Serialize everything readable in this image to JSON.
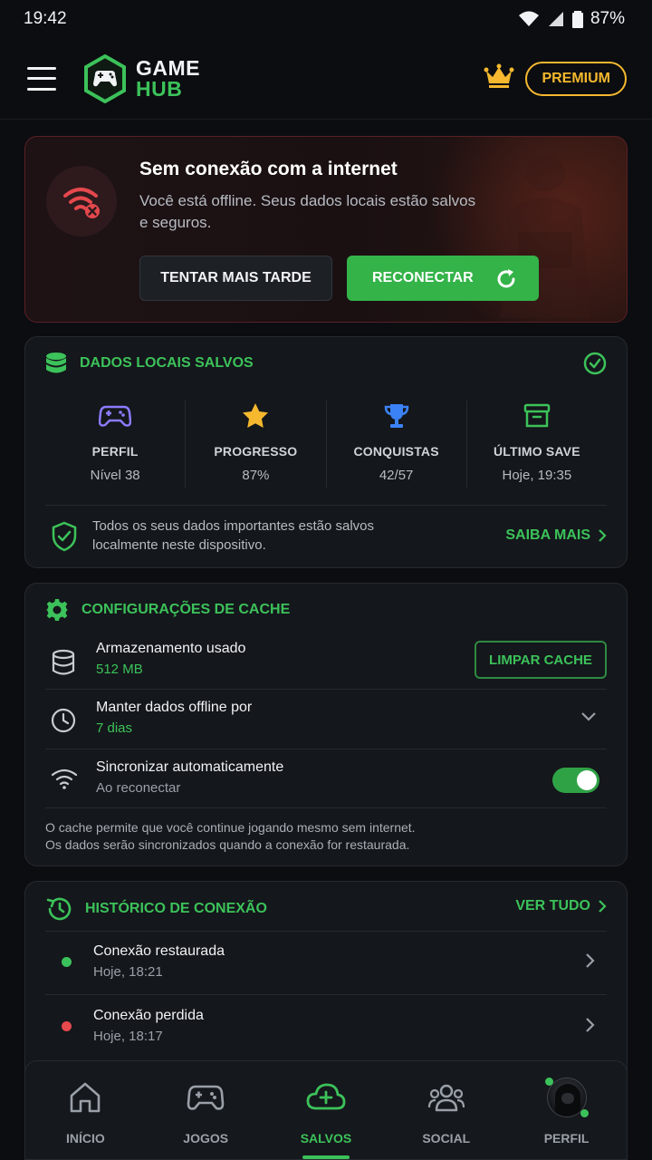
{
  "status_bar": {
    "time": "19:42",
    "battery": "87%"
  },
  "header": {
    "logo_line1": "GAME",
    "logo_line2": "HUB",
    "premium_label": "PREMIUM"
  },
  "offline_banner": {
    "title": "Sem conexão com a internet",
    "description": "Você está offline. Seus dados locais estão salvos e seguros.",
    "later_label": "TENTAR MAIS TARDE",
    "reconnect_label": "RECONECTAR"
  },
  "local_data": {
    "title": "DADOS LOCAIS SALVOS",
    "stats": [
      {
        "label": "PERFIL",
        "value": "Nível 38",
        "icon": "gamepad-icon"
      },
      {
        "label": "PROGRESSO",
        "value": "87%",
        "icon": "star-icon"
      },
      {
        "label": "CONQUISTAS",
        "value": "42/57",
        "icon": "trophy-icon"
      },
      {
        "label": "ÚLTIMO SAVE",
        "value": "Hoje, 19:35",
        "icon": "archive-box-icon"
      }
    ],
    "note": "Todos os seus dados importantes estão salvos localmente neste dispositivo.",
    "more_label": "SAIBA MAIS"
  },
  "cache": {
    "title": "CONFIGURAÇÕES DE CACHE",
    "storage_title": "Armazenamento usado",
    "storage_value": "512 MB",
    "clear_label": "LIMPAR CACHE",
    "keep_title": "Manter dados offline por",
    "keep_value": "7 dias",
    "sync_title": "Sincronizar automaticamente",
    "sync_value": "Ao reconectar",
    "sync_enabled": true,
    "note_line1": "O cache permite que você continue jogando mesmo sem internet.",
    "note_line2": "Os dados serão sincronizados quando a conexão for restaurada."
  },
  "history": {
    "title": "HISTÓRICO DE CONEXÃO",
    "see_all_label": "VER TUDO",
    "items": [
      {
        "title": "Conexão restaurada",
        "time": "Hoje, 18:21",
        "status_color": "#3cc25a"
      },
      {
        "title": "Conexão perdida",
        "time": "Hoje, 18:17",
        "status_color": "#e5484d"
      }
    ]
  },
  "bottom_nav": {
    "items": [
      {
        "label": "INÍCIO",
        "icon": "home-icon"
      },
      {
        "label": "JOGOS",
        "icon": "gamepad-icon"
      },
      {
        "label": "SALVOS",
        "icon": "cloud-plus-icon",
        "active": true
      },
      {
        "label": "SOCIAL",
        "icon": "users-icon"
      },
      {
        "label": "PERFIL",
        "icon": "avatar"
      }
    ]
  },
  "colors": {
    "accent": "#3cc25a",
    "premium": "#f5b82e",
    "danger": "#e5484d",
    "background": "#0b0d10"
  }
}
